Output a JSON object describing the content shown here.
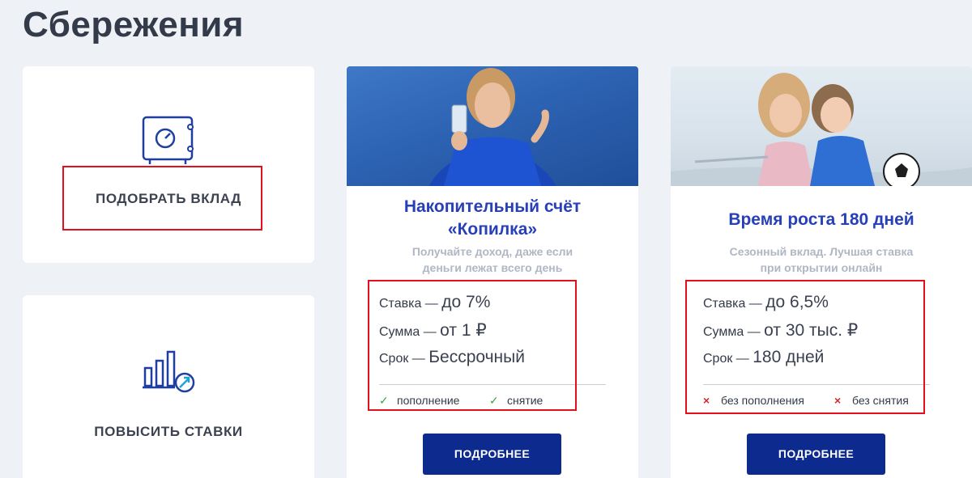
{
  "page_title": "Сбережения",
  "tiles": {
    "pick_deposit": {
      "label": "ПОДОБРАТЬ ВКЛАД",
      "icon": "safe-icon"
    },
    "raise_rates": {
      "label": "ПОВЫСИТЬ СТАВКИ",
      "icon": "bar-chart-growth-icon"
    }
  },
  "cards": [
    {
      "title_line1": "Накопительный счёт",
      "title_line2": "«Копилка»",
      "subtitle_line1": "Получайте доход, даже если",
      "subtitle_line2": "деньги лежат всего день",
      "rate_label": "Ставка — ",
      "rate_value": "до 7%",
      "sum_label": "Сумма — ",
      "sum_value": "от 1 ₽",
      "term_label": "Срок — ",
      "term_value": "Бессрочный",
      "features": [
        {
          "text": "пополнение",
          "allowed": true
        },
        {
          "text": "снятие",
          "allowed": true
        }
      ],
      "button_label": "ПОДРОБНЕЕ"
    },
    {
      "title_line1": "Время роста 180 дней",
      "subtitle_line1": "Сезонный вклад. Лучшая ставка",
      "subtitle_line2": "при открытии онлайн",
      "rate_label": "Ставка — ",
      "rate_value": "до 6,5%",
      "sum_label": "Сумма — ",
      "sum_value": "от 30 тыс. ₽",
      "term_label": "Срок — ",
      "term_value": "180 дней",
      "features": [
        {
          "text": "без пополнения",
          "allowed": false
        },
        {
          "text": "без снятия",
          "allowed": false
        }
      ],
      "button_label": "ПОДРОБНЕЕ"
    }
  ],
  "colors": {
    "accent_blue": "#0d2b8f",
    "title_blue": "#2740b8",
    "icon_blue": "#1f3fa0",
    "check_green": "#3aa53c",
    "cross_red": "#d3262e",
    "highlight_red": "#e3101c"
  }
}
